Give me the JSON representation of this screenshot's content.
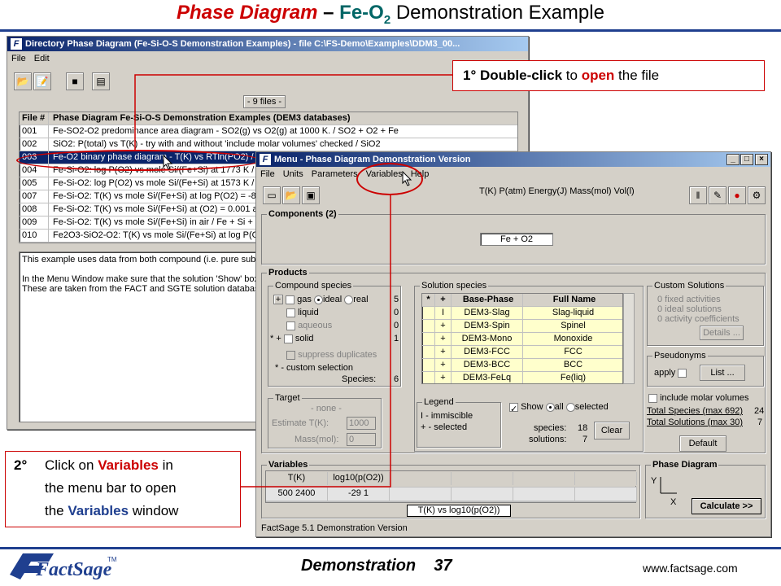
{
  "slide": {
    "title_part1": "Phase Diagram",
    "title_dash": " – ",
    "title_part2": "Fe-O",
    "title_sub": "2",
    "title_part3": " Demonstration Example",
    "footer_center": "Demonstration    37",
    "footer_url": "www.factsage.com",
    "logo_text": "FactSage",
    "logo_tm": "TM"
  },
  "callout1": {
    "prefix": "1°  ",
    "bold": "Double-click",
    "mid": " to ",
    "red": "open",
    "suffix": " the file"
  },
  "callout2": {
    "num": "2°",
    "line1a": "Click on ",
    "line1b": "Variables",
    "line1c": " in",
    "line2": "the menu bar to open",
    "line3a": "the ",
    "line3b": "Variables",
    "line3c": " window"
  },
  "dir_window": {
    "title": "Directory  Phase Diagram  (Fe-Si-O-S Demonstration Examples) - file C:\\FS-Demo\\Examples\\DDM3_00...",
    "menu": [
      "File",
      "Edit"
    ],
    "files_count": "- 9 files -",
    "headers": [
      "File #",
      "Phase Diagram Fe-Si-O-S Demonstration Examples (DEM3 databases)"
    ],
    "rows": [
      [
        "001",
        "Fe-SO2-O2 predominance area diagram - SO2(g) vs O2(g) at 1000 K. / SO2 +  O2 +  Fe"
      ],
      [
        "002",
        "SiO2:  P(total) vs T(K) - try with and without 'include molar volumes' checked / SiO2"
      ],
      [
        "003",
        "Fe-O2 binary phase diagram - T(K) vs RTln(PO2) / Fe"
      ],
      [
        "004",
        "Fe-Si-O2:  log P(O2) vs mole Si/(Fe+Si) at 1773 K / Fe"
      ],
      [
        "005",
        "Fe-Si-O2:  log P(O2) vs mole Si/(Fe+Si) at 1573 K / Fe"
      ],
      [
        "007",
        "Fe-Si-O2: T(K)  vs mole Si/(Fe+Si) at log P(O2) = -8 /"
      ],
      [
        "008",
        "Fe-Si-O2: T(K)  vs mole Si/(Fe+Si) at (O2) = 0.001 at"
      ],
      [
        "009",
        "Fe-Si-O2: T(K)  vs mole Si/(Fe+Si) in air / Fe +  Si +"
      ],
      [
        "010",
        "Fe2O3-SiO2-O2: T(K)  vs mole Si/(Fe+Si) at log P(O2)"
      ]
    ],
    "desc_lines": [
      "This example uses data from both compound (i.e. pure substa",
      "",
      "In the Menu Window make sure that the solution 'Show' box",
      "These are taken from the FACT and SGTE solution database"
    ]
  },
  "menu_window": {
    "title": "Menu - Phase Diagram Demonstration Version",
    "menu": [
      "File",
      "Units",
      "Parameters",
      "Variables",
      "Help"
    ],
    "units": "T(K)  P(atm)  Energy(J)  Mass(mol)  Vol(l)",
    "components_label": "Components  (2)",
    "components_value": "Fe  +  O2",
    "products_label": "Products",
    "compound": {
      "label": "Compound species",
      "rows": [
        {
          "mark": "+",
          "name": "gas",
          "radio1": "ideal",
          "radio2": "real",
          "count": "5"
        },
        {
          "mark": "",
          "name": "liquid",
          "count": "0"
        },
        {
          "mark": "",
          "name": "aqueous",
          "count": "0"
        },
        {
          "mark": "* +",
          "name": "solid",
          "count": "1"
        }
      ],
      "suppress": "suppress duplicates",
      "custom": "* - custom selection",
      "species_label": "Species:",
      "species_count": "6"
    },
    "solution": {
      "label": "Solution species",
      "headers": [
        "*",
        "+",
        "Base-Phase",
        "Full Name"
      ],
      "rows": [
        [
          "",
          "I",
          "DEM3-Slag",
          "Slag-liquid"
        ],
        [
          "",
          "+",
          "DEM3-Spin",
          "Spinel"
        ],
        [
          "",
          "+",
          "DEM3-Mono",
          "Monoxide"
        ],
        [
          "",
          "+",
          "DEM3-FCC",
          "FCC"
        ],
        [
          "",
          "+",
          "DEM3-BCC",
          "BCC"
        ],
        [
          "",
          "+",
          "DEM3-FeLq",
          "Fe(liq)"
        ]
      ],
      "legend_label": "Legend",
      "legend1": "I - immiscible",
      "legend2": "+ - selected",
      "show": "Show",
      "all": "all",
      "selected": "selected",
      "species_label": "species:",
      "species_count": "18",
      "solutions_label": "solutions:",
      "solutions_count": "7",
      "clear": "Clear"
    },
    "custom_solutions": {
      "label": "Custom Solutions",
      "items": [
        "0  fixed activities",
        "0  ideal solutions",
        "0  activity coefficients"
      ],
      "details": "Details ..."
    },
    "pseudonyms": {
      "label": "Pseudonyms",
      "apply": "apply",
      "list": "List ..."
    },
    "include_molar": "include molar volumes",
    "total_species_label": "Total Species (max 692)",
    "total_species": "24",
    "total_solutions_label": "Total Solutions (max 30)",
    "total_solutions": "7",
    "default": "Default",
    "target": {
      "label": "Target",
      "none": "- none -",
      "estimate_label": "Estimate T(K):",
      "estimate_value": "1000",
      "mass_label": "Mass(mol):",
      "mass_value": "0"
    },
    "variables": {
      "label": "Variables",
      "headers": [
        "T(K)",
        "log10(p(O2))",
        "",
        "",
        "",
        ""
      ],
      "values": [
        "500 2400",
        "-29 1",
        "",
        "",
        "",
        ""
      ],
      "axis_label": "T(K)  vs  log10(p(O2))"
    },
    "phase_diagram": {
      "label": "Phase Diagram",
      "y": "Y",
      "x": "X",
      "calculate": "Calculate >>"
    },
    "status": "FactSage 5.1 Demonstration Version"
  }
}
